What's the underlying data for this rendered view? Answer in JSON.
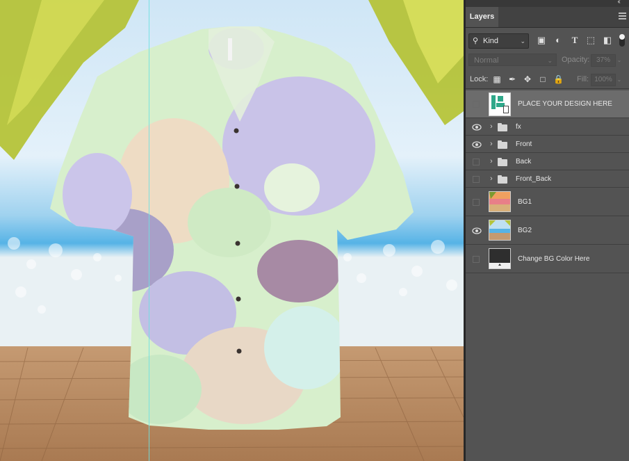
{
  "canvas": {
    "scene_icon": "hawaiian-shirt-mockup-artwork"
  },
  "panel": {
    "tab_label": "Layers",
    "collapse_icon": "double-chevron-icon",
    "menu_icon": "hamburger-menu-icon",
    "filter": {
      "kind_label": "Kind",
      "icons": [
        "image-filter-icon",
        "adjustment-filter-icon",
        "type-filter-icon",
        "shape-filter-icon",
        "smart-object-filter-icon"
      ]
    },
    "blend_mode": "Normal",
    "opacity_label": "Opacity:",
    "opacity_value": "37%",
    "lock_label": "Lock:",
    "lock_icons": [
      "lock-transparency-icon",
      "lock-brush-icon",
      "lock-position-icon",
      "lock-artboard-icon",
      "lock-all-icon"
    ],
    "fill_label": "Fill:",
    "fill_value": "100%"
  },
  "layers": [
    {
      "name": "PLACE YOUR DESIGN HERE",
      "type": "smart-object",
      "visible": false,
      "selected": true
    },
    {
      "name": "fx",
      "type": "group",
      "visible": true,
      "selected": false
    },
    {
      "name": "Front",
      "type": "group",
      "visible": true,
      "selected": false
    },
    {
      "name": "Back",
      "type": "group",
      "visible": false,
      "selected": false
    },
    {
      "name": "Front_Back",
      "type": "group",
      "visible": false,
      "selected": false
    },
    {
      "name": "BG1",
      "type": "image",
      "visible": false,
      "selected": false
    },
    {
      "name": "BG2",
      "type": "image",
      "visible": true,
      "selected": false
    },
    {
      "name": "Change BG Color Here",
      "type": "fill",
      "visible": false,
      "selected": false
    }
  ],
  "colors": {
    "panel_bg": "#535353",
    "selected_row": "#6c6c6c",
    "guide": "#6ee0e0"
  }
}
